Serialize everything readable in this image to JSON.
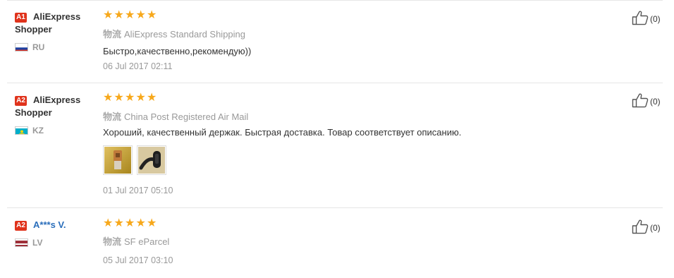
{
  "reviews": [
    {
      "badge": "A1",
      "user": "AliExpress Shopper",
      "country": "RU",
      "flag_colors": [
        "#ffffff",
        "#1c3fa0",
        "#d52b1e"
      ],
      "stars": 5,
      "shipping_label": "物流",
      "shipping": "AliExpress Standard Shipping",
      "text": "Быстро,качественно,рекомендую))",
      "date": "06 Jul 2017 02:11",
      "likes": "(0)"
    },
    {
      "badge": "A2",
      "user": "AliExpress Shopper",
      "country": "KZ",
      "flag_colors": [
        "#00aeca",
        "#ffd700"
      ],
      "stars": 5,
      "shipping_label": "物流",
      "shipping": "China Post Registered Air Mail",
      "text": "Хороший, качественный держак. Быстрая доставка. Товар соответствует описанию.",
      "photos": [
        "review-photo-1",
        "review-photo-2"
      ],
      "date": "01 Jul 2017 05:10",
      "likes": "(0)"
    },
    {
      "badge": "A2",
      "user": "A***s V.",
      "country": "LV",
      "flag_colors": [
        "#9e3039",
        "#ffffff"
      ],
      "stars": 5,
      "shipping_label": "物流",
      "shipping": "SF eParcel",
      "date": "05 Jul 2017 03:10",
      "likes": "(0)"
    }
  ],
  "colors": {
    "star": "#f7a81b",
    "badge": "#e0331c",
    "link": "#2a6ebb",
    "muted": "#999999"
  },
  "icons": {
    "star": "star-icon",
    "like": "thumbs-up-icon"
  }
}
